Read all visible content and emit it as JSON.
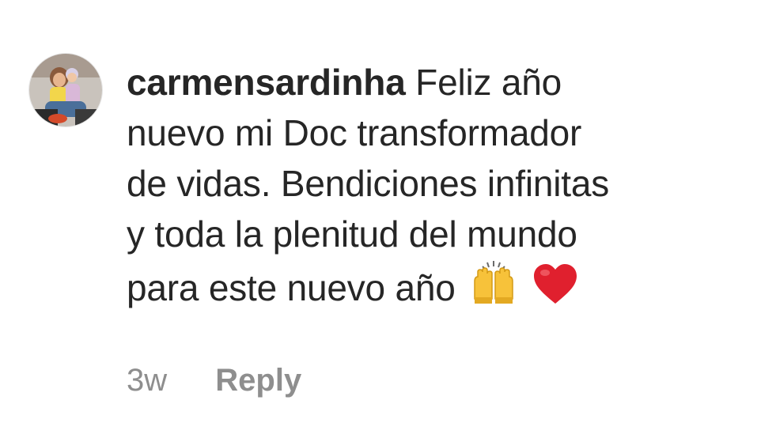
{
  "comment": {
    "username": "carmensardinha",
    "lines": [
      "Feliz año",
      "nuevo mi Doc transformador",
      "de vidas. Bendiciones infinitas",
      "y toda la plenitud del mundo",
      "para este nuevo año"
    ],
    "emojis": [
      "raising-hands-icon",
      "red-heart-icon"
    ],
    "time": "3w",
    "reply_label": "Reply"
  },
  "colors": {
    "text": "#262626",
    "meta": "#8e8e8e",
    "heart": "#e0202e",
    "hands": "#f7c23a"
  }
}
